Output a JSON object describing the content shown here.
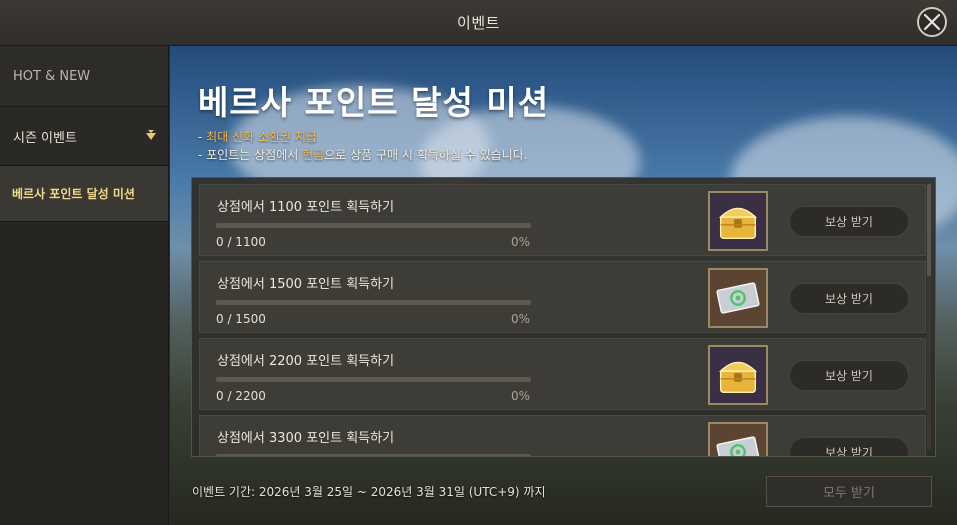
{
  "window": {
    "title": "이벤트"
  },
  "sidebar": {
    "hot_new": "HOT & NEW",
    "season_event": "시즌 이벤트",
    "active_item": "베르사 포인트 달성 미션"
  },
  "event": {
    "headline": "베르사 포인트 달성 미션",
    "note1_prefix": "- ",
    "note1_highlight": "최대 신화 소환권 지급",
    "note2_prefix": "- 포인트는 상점에서 ",
    "note2_highlight": "현금",
    "note2_suffix": "으로 상품 구매 시 획득하실 수 있습니다."
  },
  "missions": [
    {
      "label": "상점에서 1100 포인트 획득하기",
      "count": "0 / 1100",
      "percent": "0%",
      "progress": 0,
      "reward_icon": "gold-chest-icon",
      "claim_label": "보상 받기"
    },
    {
      "label": "상점에서 1500 포인트 획득하기",
      "count": "0 / 1500",
      "percent": "0%",
      "progress": 0,
      "reward_icon": "summon-ticket-icon",
      "claim_label": "보상 받기"
    },
    {
      "label": "상점에서 2200 포인트 획득하기",
      "count": "0 / 2200",
      "percent": "0%",
      "progress": 0,
      "reward_icon": "gold-chest-icon",
      "claim_label": "보상 받기"
    },
    {
      "label": "상점에서 3300 포인트 획득하기",
      "count": "",
      "percent": "",
      "progress": 0,
      "reward_icon": "summon-ticket-icon",
      "claim_label": "보상 받기"
    }
  ],
  "footer": {
    "period": "이벤트 기간: 2026년 3월 25일 ~ 2026년 3월 31일 (UTC+9) 까지",
    "claim_all": "모두 받기"
  },
  "colors": {
    "highlight": "#f5b84a",
    "active_menu": "#f2d98a"
  }
}
